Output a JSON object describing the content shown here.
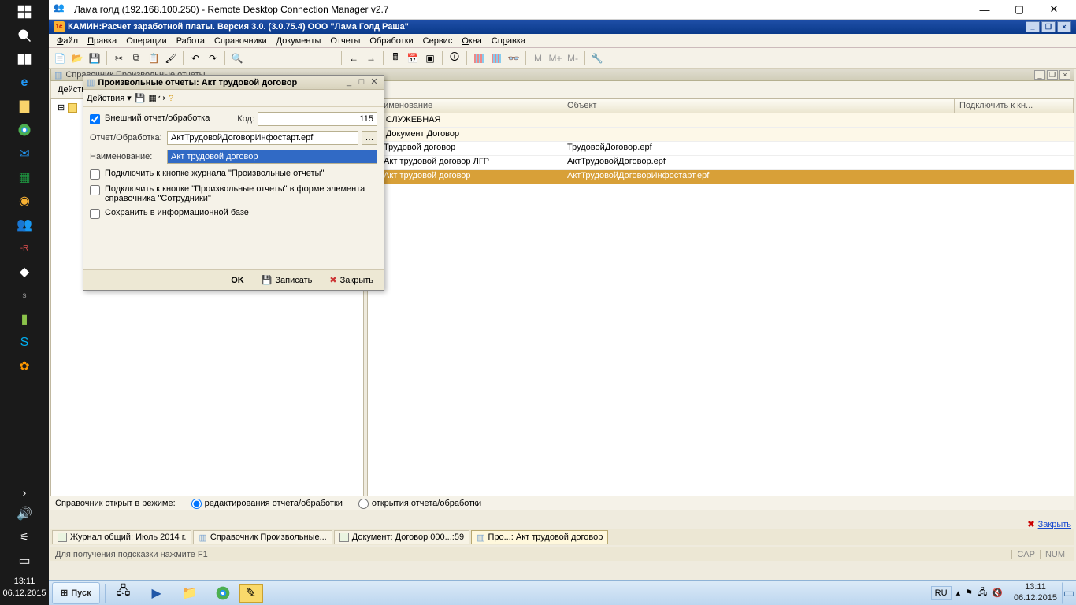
{
  "win_taskbar": {
    "clock_time": "13:11",
    "clock_date": "06.12.2015"
  },
  "rdcman": {
    "title": "Лама голд (192.168.100.250) - Remote Desktop Connection Manager v2.7"
  },
  "app": {
    "title": "КАМИН:Расчет заработной платы. Версия 3.0. (3.0.75.4) ООО \"Лама Голд Раша\"",
    "menu": [
      "Файл",
      "Правка",
      "Операции",
      "Работа",
      "Справочники",
      "Документы",
      "Отчеты",
      "Обработки",
      "Сервис",
      "Окна",
      "Справка"
    ],
    "mdi_title": "Справочник Произвольные отчеты",
    "actions_label": "Действия"
  },
  "dialog": {
    "title": "Произвольные отчеты: Акт трудовой договор",
    "actions": "Действия",
    "cb_external": "Внешний отчет/обработка",
    "code_label": "Код:",
    "code_value": "115",
    "report_label": "Отчет/Обработка:",
    "report_value": "АктТрудовойДоговорИнфостарт.epf",
    "name_label": "Наименование:",
    "name_value": "Акт трудовой договор",
    "cb_btn1": "Подключить к кнопке журнала \"Произвольные отчеты\"",
    "cb_btn2": "Подключить к кнопке \"Произвольные отчеты\" в форме элемента справочника \"Сотрудники\"",
    "cb_save": "Сохранить в информационной базе",
    "ok": "OK",
    "save": "Записать",
    "close": "Закрыть"
  },
  "grid": {
    "columns": [
      "Наименование",
      "Объект",
      "Подключить к кн..."
    ],
    "rows": [
      {
        "group": true,
        "name": "СЛУЖЕБНАЯ",
        "obj": ""
      },
      {
        "group": true,
        "name": "Документ Договор",
        "obj": ""
      },
      {
        "name": "Трудовой договор",
        "obj": "ТрудовойДоговор.epf"
      },
      {
        "name": "Акт трудовой договор ЛГР",
        "obj": "АктТрудовойДоговор.epf"
      },
      {
        "name": "Акт трудовой договор",
        "obj": "АктТрудовойДоговорИнфостарт.epf",
        "selected": true
      }
    ]
  },
  "radiobar": {
    "label": "Справочник открыт в режиме:",
    "r1": "редактирования отчета/обработки",
    "r2": "открытия отчета/обработки"
  },
  "closebtn": "Закрыть",
  "wintabs": [
    "Журнал общий: Июль 2014 г.",
    "Справочник Произвольные...",
    "Документ: Договор 000...:59",
    "Про...: Акт трудовой договор"
  ],
  "statusbar": {
    "hint": "Для получения подсказки нажмите F1",
    "cap": "CAP",
    "num": "NUM"
  },
  "inner_tb": {
    "start": "Пуск",
    "lang": "RU",
    "clock_time": "13:11",
    "clock_date": "06.12.2015"
  }
}
